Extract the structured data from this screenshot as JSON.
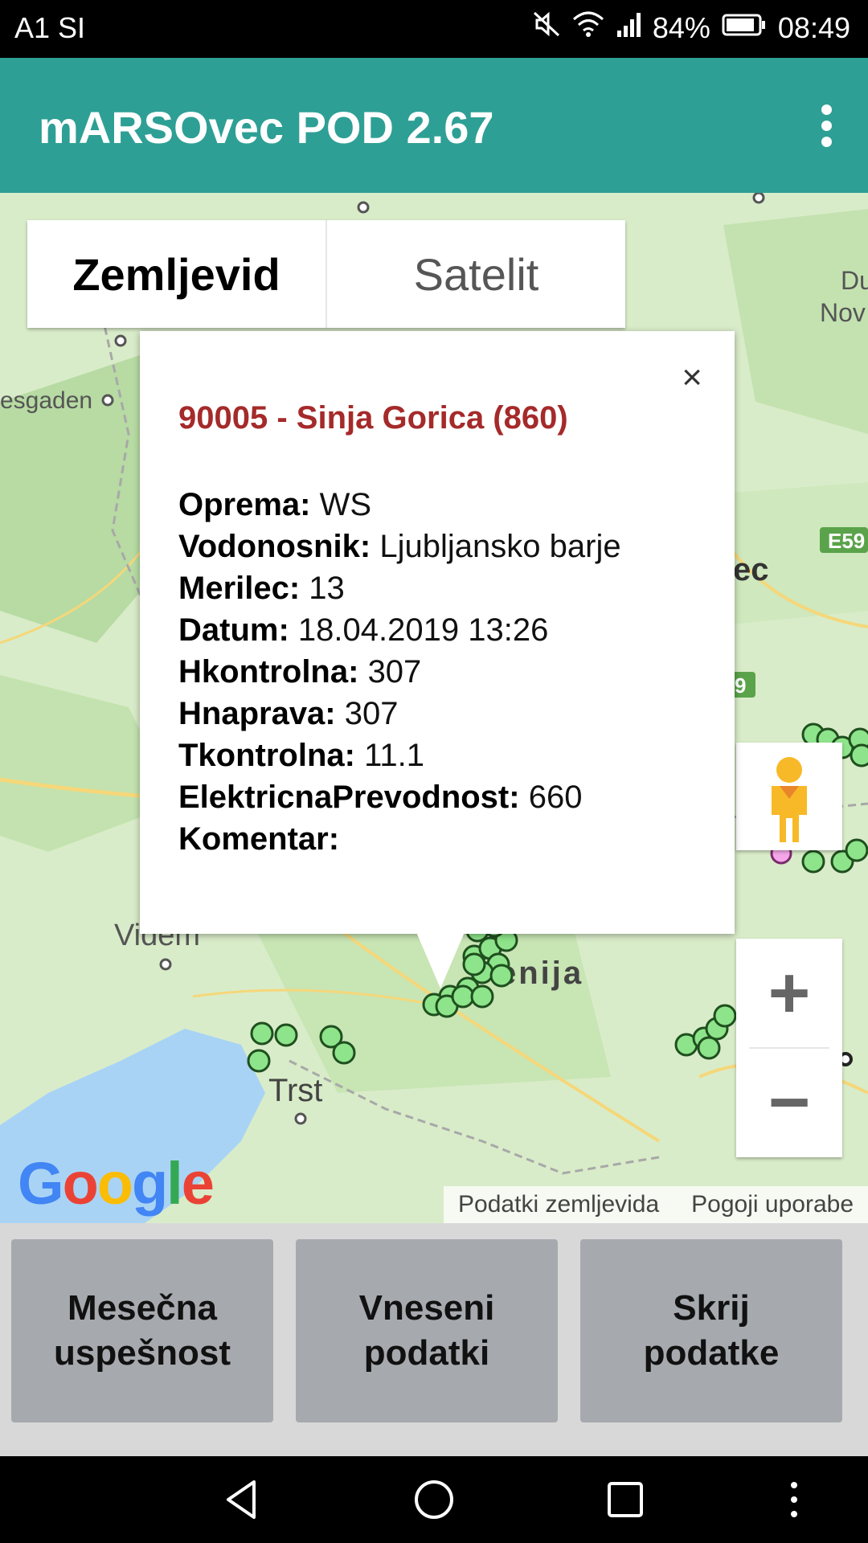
{
  "status_bar": {
    "carrier": "A1 SI",
    "battery": "84%",
    "time": "08:49"
  },
  "app_bar": {
    "title": "mARSOvec POD 2.67"
  },
  "map_type": {
    "map_label": "Zemljevid",
    "satellite_label": "Satelit"
  },
  "map_labels": {
    "videm": "Videm",
    "trst": "Trst",
    "slovenija": "enija",
    "esgaden": "esgaden",
    "du": "Du",
    "nov": "Nov",
    "ec": "ec",
    "e59": "E59",
    "nine": "9"
  },
  "info_window": {
    "title": "90005 - Sinja Gorica (860)",
    "close": "×",
    "rows": [
      {
        "label": "Oprema:",
        "value": "WS"
      },
      {
        "label": "Vodonosnik:",
        "value": "Ljubljansko barje"
      },
      {
        "label": "Merilec:",
        "value": "13"
      },
      {
        "label": "Datum:",
        "value": "18.04.2019 13:26"
      },
      {
        "label": "Hkontrolna:",
        "value": "307"
      },
      {
        "label": "Hnaprava:",
        "value": "307"
      },
      {
        "label": "Tkontrolna:",
        "value": "11.1"
      },
      {
        "label": "ElektricnaPrevodnost:",
        "value": "660"
      },
      {
        "label": "Komentar:",
        "value": ""
      }
    ]
  },
  "zoom": {
    "plus": "+",
    "minus": "−"
  },
  "attribution": {
    "map_data": "Podatki zemljevida",
    "terms": "Pogoji uporabe"
  },
  "google_logo": "Google",
  "bottom_buttons": [
    {
      "line1": "Mesečna",
      "line2": "uspešnost"
    },
    {
      "line1": "Vneseni",
      "line2": "podatki"
    },
    {
      "line1": "Skrij",
      "line2": "podatke"
    }
  ],
  "colors": {
    "app_bar": "#2e9f95",
    "title_red": "#a52a2a",
    "marker_green": "#7ee07a",
    "button_gray": "#a6a9ae"
  }
}
